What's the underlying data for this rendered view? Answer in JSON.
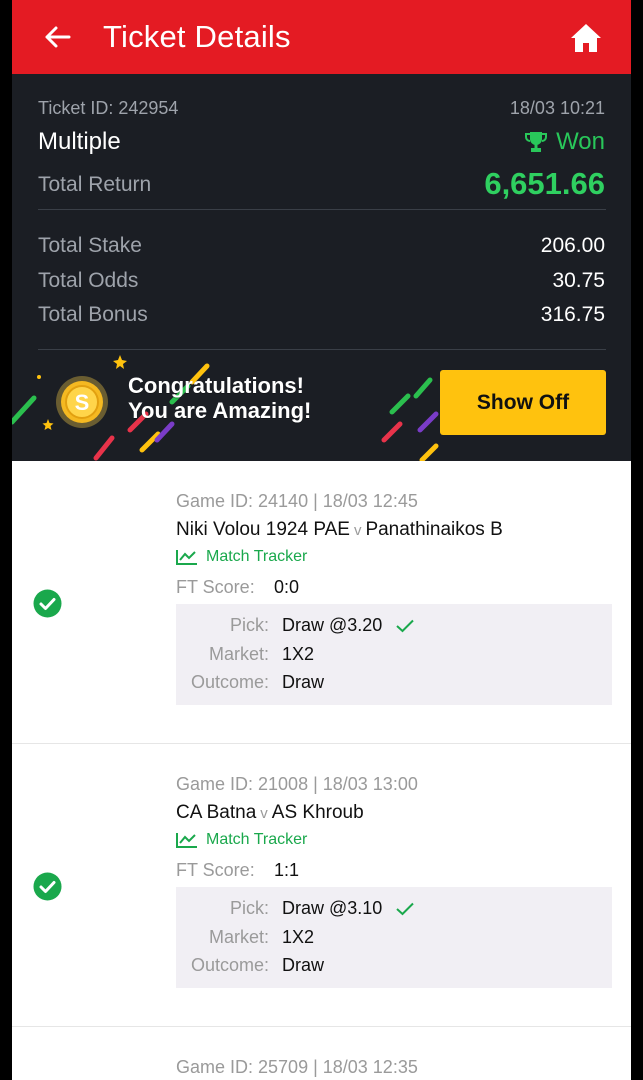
{
  "header": {
    "title": "Ticket Details",
    "back_icon": "arrow-left-icon",
    "home_icon": "home-icon",
    "bg": "#e41b23"
  },
  "summary": {
    "ticket_id": "Ticket ID: 242954",
    "datetime": "18/03 10:21",
    "bet_type": "Multiple",
    "status": "Won",
    "total_return_label": "Total Return",
    "total_return": "6,651.66",
    "total_stake_label": "Total Stake",
    "total_stake": "206.00",
    "total_odds_label": "Total Odds",
    "total_odds": "30.75",
    "total_bonus_label": "Total Bonus",
    "total_bonus": "316.75",
    "accent_green": "#2fd060"
  },
  "banner": {
    "line1": "Congratulations!",
    "line2": "You are Amazing!",
    "button": "Show Off"
  },
  "games": [
    {
      "header": "Game ID: 24140 | 18/03 12:45",
      "home": "Niki Volou 1924 PAE",
      "vs": "v",
      "away": "Panathinaikos B",
      "tracker": "Match Tracker",
      "ft_label": "FT Score:",
      "ft_score": "0:0",
      "pick_label": "Pick:",
      "pick": "Draw @3.20",
      "market_label": "Market:",
      "market": "1X2",
      "outcome_label": "Outcome:",
      "outcome": "Draw"
    },
    {
      "header": "Game ID: 21008 | 18/03 13:00",
      "home": "CA Batna",
      "vs": "v",
      "away": "AS Khroub",
      "tracker": "Match Tracker",
      "ft_label": "FT Score:",
      "ft_score": "1:1",
      "pick_label": "Pick:",
      "pick": "Draw @3.10",
      "market_label": "Market:",
      "market": "1X2",
      "outcome_label": "Outcome:",
      "outcome": "Draw"
    },
    {
      "header": "Game ID: 25709 | 18/03 12:35"
    }
  ]
}
